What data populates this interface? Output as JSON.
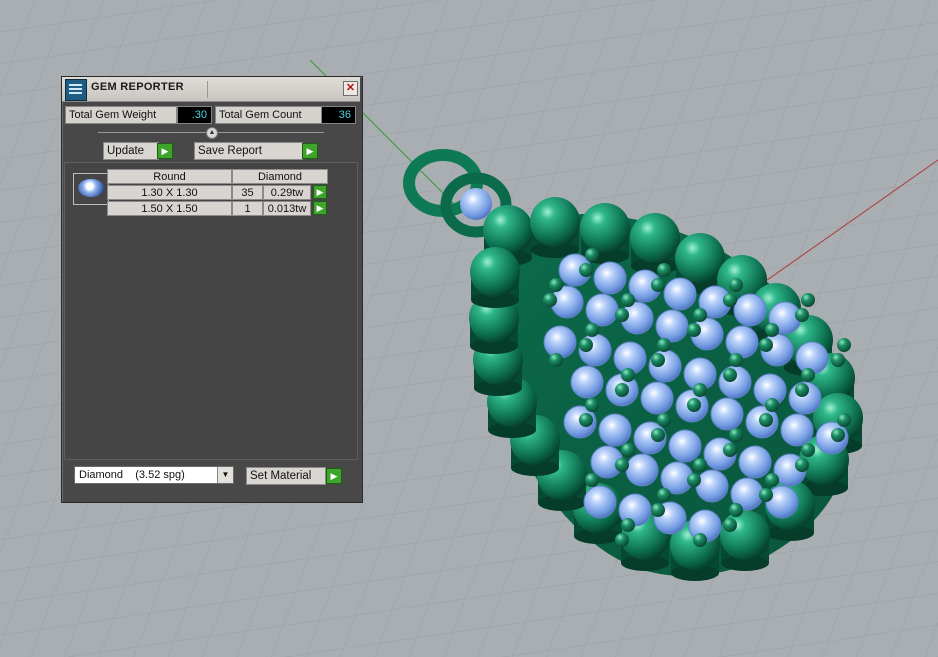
{
  "panel": {
    "title": "GEM REPORTER",
    "close_glyph": "✕",
    "total_weight_label": "Total Gem Weight",
    "total_weight_value": ".30",
    "total_count_label": "Total Gem Count",
    "total_count_value": "36",
    "update_label": "Update",
    "save_report_label": "Save Report",
    "table": {
      "headers": [
        "Round",
        "Diamond"
      ],
      "rows": [
        {
          "size": "1.30 X 1.30",
          "count": "35",
          "weight": "0.29tw"
        },
        {
          "size": "1.50 X 1.50",
          "count": "1",
          "weight": "0.013tw"
        }
      ]
    },
    "material_selected": "Diamond    (3.52 spg)",
    "set_material_label": "Set Material"
  },
  "icons": {
    "app": "gem-reporter-icon",
    "close": "close-icon",
    "arrow": "arrow-right-icon",
    "dropdown": "chevron-down-icon",
    "gem_thumb": "round-gem-icon"
  },
  "colors": {
    "model_green": "#0e7a55",
    "gem_blue": "#8fb2f2",
    "panel_bg": "#484848",
    "value_text": "#49d3e0"
  }
}
